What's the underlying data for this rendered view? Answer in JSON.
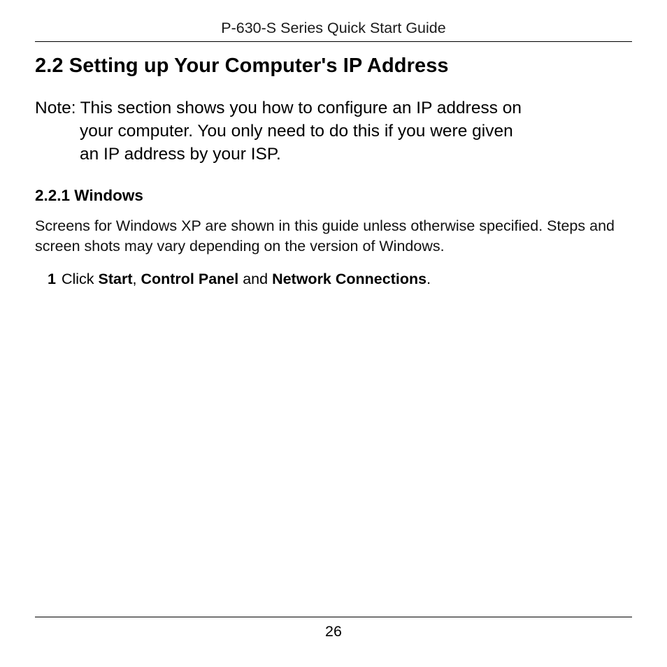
{
  "header": {
    "running_title": "P-630-S Series Quick Start Guide"
  },
  "section": {
    "heading": "2.2 Setting up Your Computer's IP Address"
  },
  "note": {
    "prefix": "Note:",
    "line1": "This section shows you how to configure an IP address on",
    "line2": "your computer. You only need to do this if you were given",
    "line3": "an IP address by your ISP."
  },
  "subsection": {
    "heading": "2.2.1 Windows",
    "para": "Screens for Windows XP are shown in this guide unless otherwise specified. Steps and screen shots may vary depending on the version of Windows."
  },
  "step1": {
    "num": "1",
    "t1": "Click ",
    "b1": "Start",
    "t2": ", ",
    "b2": "Control Panel",
    "t3": " and ",
    "b3": "Network Connections",
    "t4": "."
  },
  "footer": {
    "page_number": "26"
  }
}
